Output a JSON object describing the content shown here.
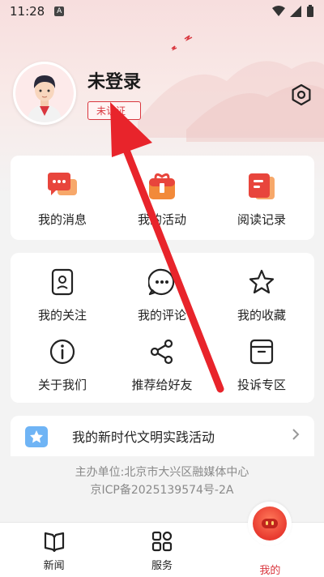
{
  "status_bar": {
    "time": "11:28",
    "sim_label": "A"
  },
  "profile": {
    "username": "未登录",
    "verify_badge": "未认证"
  },
  "quick_actions": [
    {
      "label": "我的消息",
      "icon": "message-icon"
    },
    {
      "label": "我的活动",
      "icon": "activity-icon"
    },
    {
      "label": "阅读记录",
      "icon": "reading-record-icon"
    }
  ],
  "menu_items": [
    {
      "label": "我的关注",
      "icon": "follow-icon"
    },
    {
      "label": "我的评论",
      "icon": "comment-icon"
    },
    {
      "label": "我的收藏",
      "icon": "star-icon"
    },
    {
      "label": "关于我们",
      "icon": "info-icon"
    },
    {
      "label": "推荐给好友",
      "icon": "share-icon"
    },
    {
      "label": "投诉专区",
      "icon": "complaint-icon"
    }
  ],
  "practice": {
    "label": "我的新时代文明实践活动"
  },
  "footer": {
    "line1": "主办单位:北京市大兴区融媒体中心",
    "line2": "京ICP备2025139574号-2A"
  },
  "tabs": [
    {
      "label": "新闻",
      "icon": "book-icon"
    },
    {
      "label": "服务",
      "icon": "grid-icon"
    },
    {
      "label": "我的",
      "icon": "mine-icon",
      "active": true
    }
  ],
  "colors": {
    "accent": "#d9363e",
    "arrow": "#e8242b"
  }
}
